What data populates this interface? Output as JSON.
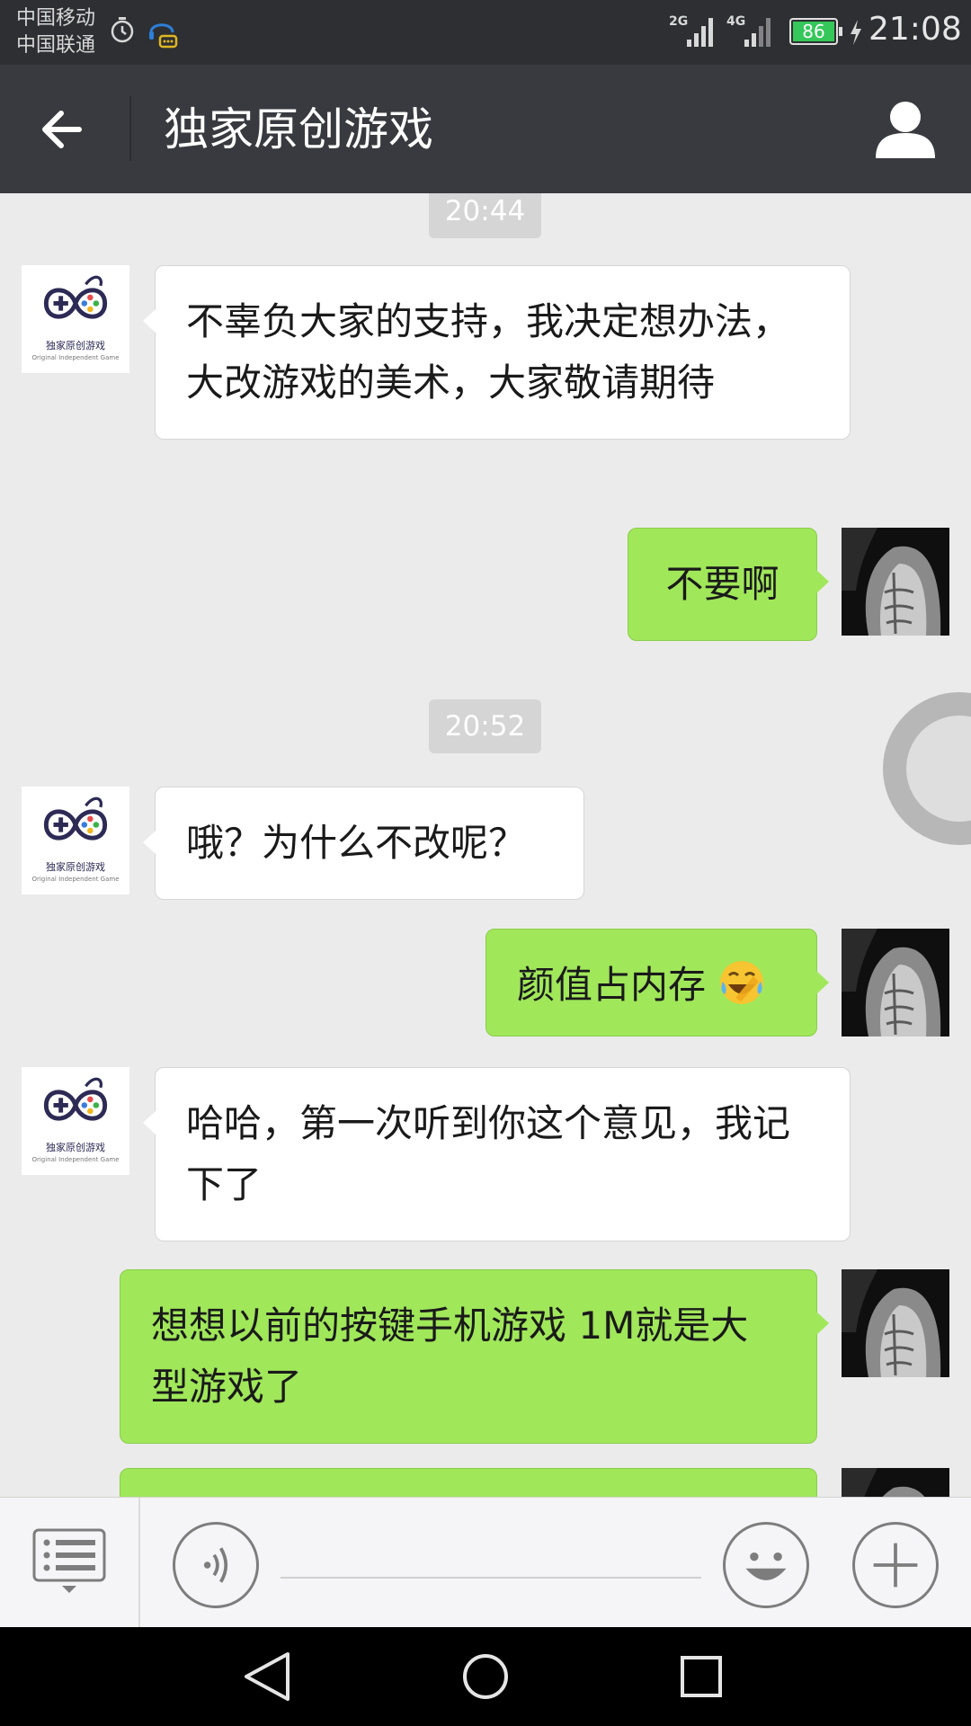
{
  "status_bar": {
    "carrier_1": "中国移动",
    "carrier_2": "中国联通",
    "network_1": "2G",
    "network_2": "4G",
    "battery": "86",
    "time": "21:08"
  },
  "header": {
    "title": "独家原创游戏"
  },
  "logo": {
    "name": "独家原创游戏",
    "tagline": "Original Independent Game"
  },
  "messages": [
    {
      "type": "time",
      "text": "20:44"
    },
    {
      "type": "incoming",
      "text": "不辜负大家的支持，我决定想办法，大改游戏的美术，大家敬请期待"
    },
    {
      "type": "outgoing",
      "text": "不要啊"
    },
    {
      "type": "time",
      "text": "20:52"
    },
    {
      "type": "incoming",
      "text": "哦？为什么不改呢？"
    },
    {
      "type": "outgoing",
      "text": "颜值占内存",
      "emoji": "face-with-tears-of-joy"
    },
    {
      "type": "incoming",
      "text": "哈哈，第一次听到你这个意见，我记下了"
    },
    {
      "type": "outgoing",
      "text": "想想以前的按键手机游戏 1M就是大型游戏了"
    }
  ],
  "colors": {
    "outgoing_bubble": "#a0e75a",
    "incoming_bubble": "#ffffff",
    "header_bg": "#393a3f",
    "chat_bg": "#ebebeb"
  },
  "icons": {
    "back": "arrow-left-icon",
    "profile": "person-icon",
    "menu": "list-menu-icon",
    "voice": "voice-icon",
    "emoji": "smiley-icon",
    "more": "plus-icon"
  }
}
